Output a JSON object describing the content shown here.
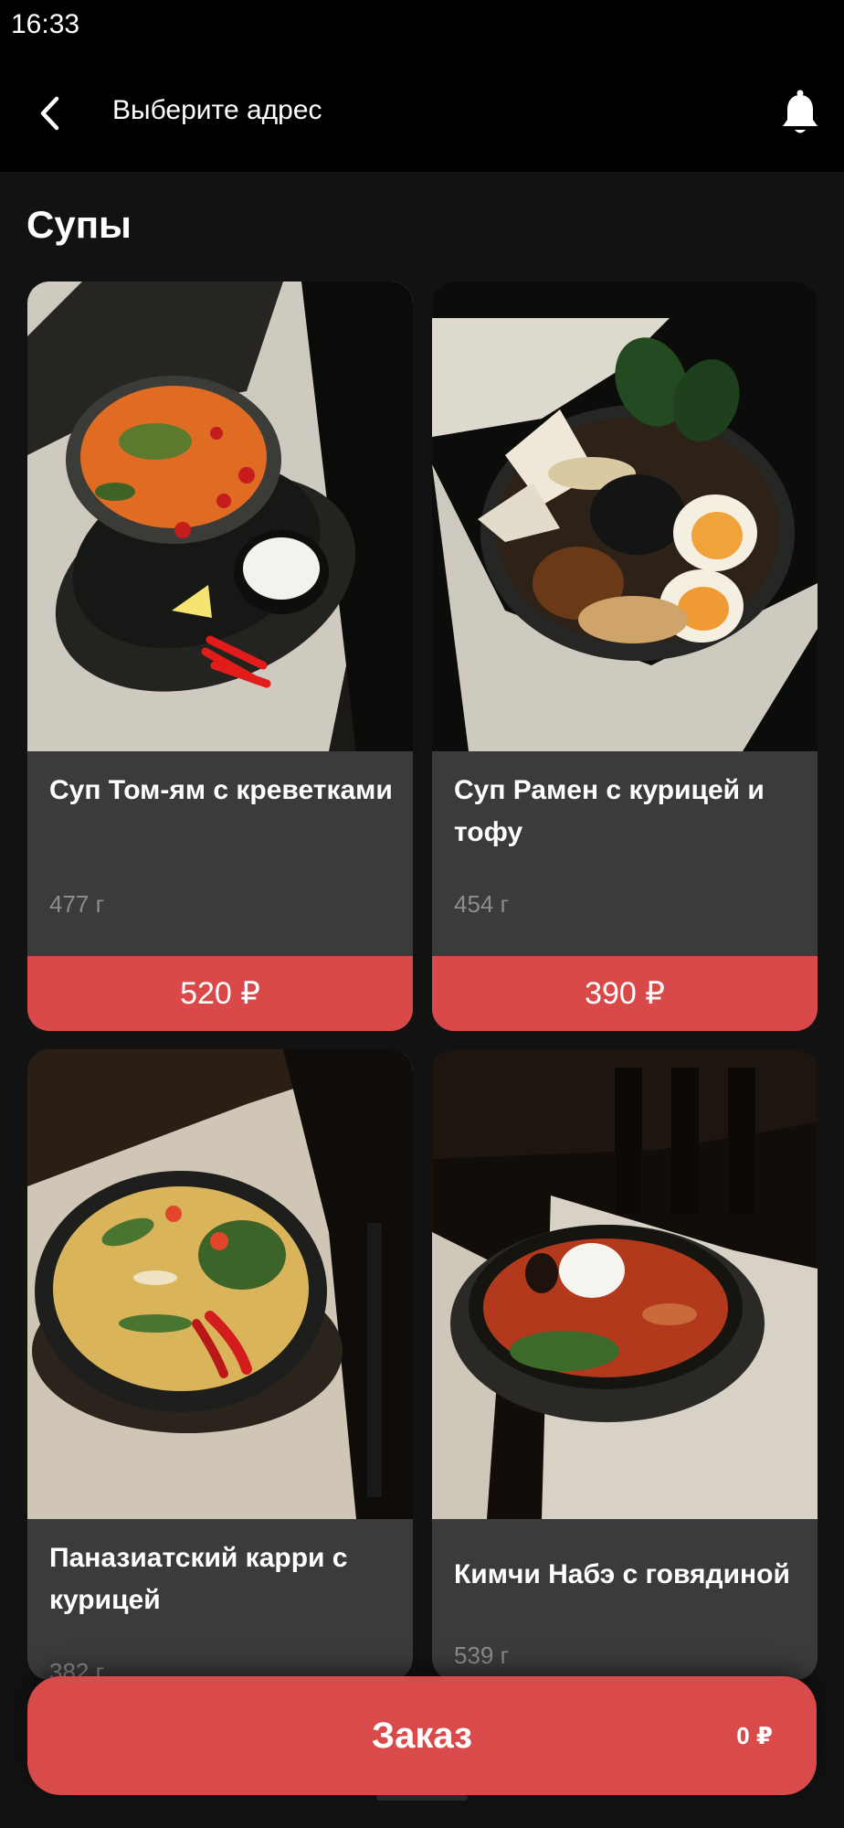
{
  "status_bar": {
    "time": "16:33"
  },
  "header": {
    "back_icon": "chevron-left-icon",
    "title": "Выберите адрес",
    "notification_icon": "bell-icon"
  },
  "section": {
    "title": "Супы"
  },
  "products": [
    {
      "name": "Суп Том-ям с креветками",
      "weight": "477 г",
      "price": "520 ₽"
    },
    {
      "name": "Суп Рамен с курицей и тофу",
      "weight": "454 г",
      "price": "390 ₽"
    },
    {
      "name": "Паназиатский карри с курицей",
      "weight": "382 г"
    },
    {
      "name": "Кимчи Набэ с говядиной",
      "weight": "539 г"
    }
  ],
  "order_bar": {
    "label": "Заказ",
    "total": "0 ₽"
  },
  "colors": {
    "accent": "#d9494a",
    "background": "#121212",
    "card": "#3b3b3b",
    "header": "#000000",
    "muted_text": "#8c8c8c"
  }
}
